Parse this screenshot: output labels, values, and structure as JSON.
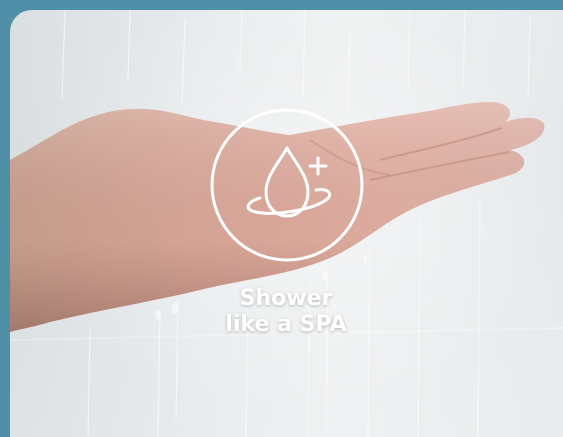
{
  "headline": {
    "line1": "Shower",
    "line2": "like a SPA"
  },
  "icon": {
    "name": "water-drop-plus-icon",
    "color": "#ffffff"
  },
  "colors": {
    "frame": "#4f8fa8",
    "text": "#ffffff"
  }
}
